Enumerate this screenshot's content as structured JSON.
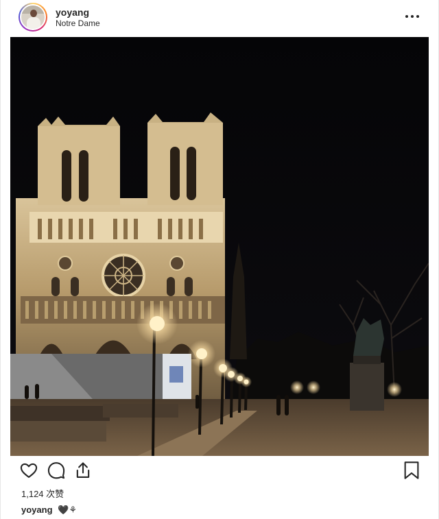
{
  "post": {
    "username": "yoyang",
    "location": "Notre Dame",
    "likes_text": "1,124 次赞",
    "caption_user": "yoyang",
    "caption_text": "🖤⚘"
  },
  "icons": {
    "more": "more-options-icon",
    "like": "heart-icon",
    "comment": "comment-icon",
    "share": "share-icon",
    "save": "bookmark-icon"
  },
  "photo": {
    "subject": "Notre-Dame cathedral at night",
    "sky_color": "#070709",
    "light_color": "#f6d9a0"
  }
}
